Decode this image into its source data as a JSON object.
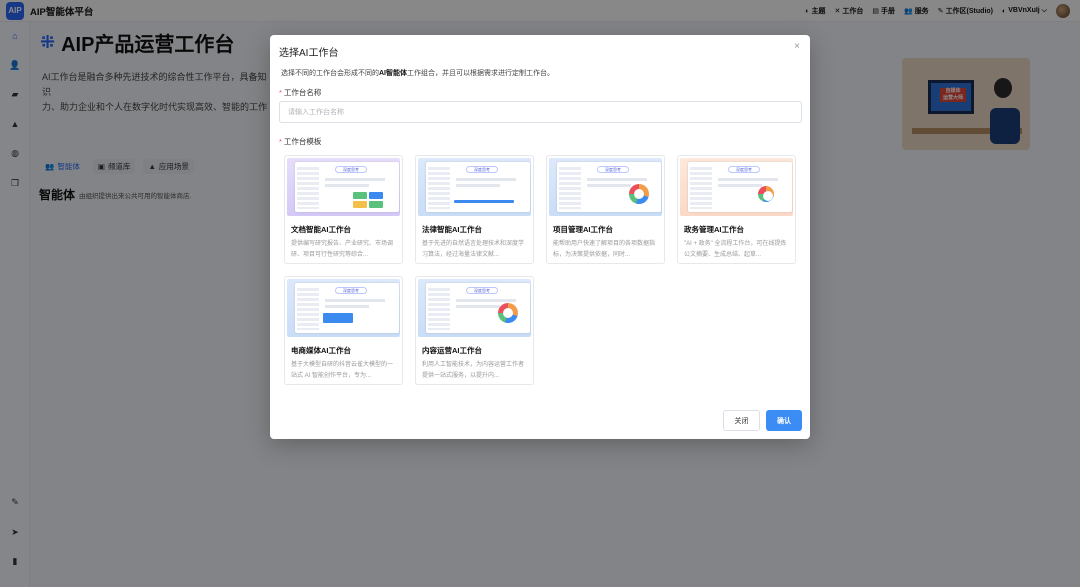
{
  "app": {
    "logo": "AIP",
    "title": "AIP智能体平台"
  },
  "topnav": [
    {
      "icon": "theme-icon",
      "glyph": "◐",
      "label": "主题"
    },
    {
      "icon": "workbench-icon",
      "glyph": "✕",
      "label": "工作台"
    },
    {
      "icon": "manual-icon",
      "glyph": "▤",
      "label": "手册"
    },
    {
      "icon": "service-icon",
      "glyph": "👥",
      "label": "服务"
    },
    {
      "icon": "workspace-icon",
      "glyph": "✎",
      "label": "工作区(Studio)"
    },
    {
      "icon": "user-icon",
      "glyph": "◐",
      "label": "VBVnXuIj ⌵"
    }
  ],
  "sidebar": [
    "home-icon",
    "user-icon",
    "box-icon",
    "layers-icon",
    "chat-icon",
    "copy-icon"
  ],
  "sidebar_bottom": [
    "pen-icon",
    "send-icon",
    "message-icon"
  ],
  "page": {
    "title": "AIP产品运营工作台",
    "intro": "AI工作台是融合多种先进技术的综合性工作平台，具备知识\n力、助力企业和个人在数字化时代实现高效、智能的工作",
    "hero_text": "自媒体\n运营大师",
    "tabs": [
      {
        "label": "智能体",
        "glyph": "👥"
      },
      {
        "label": "频道库",
        "glyph": "▣"
      },
      {
        "label": "应用场景",
        "glyph": "▲"
      }
    ],
    "section_title": "智能体",
    "section_sub": "由组织提供出来公共可用的智能体商店."
  },
  "modal": {
    "title": "选择AI工作台",
    "close_glyph": "×",
    "desc_pre": "选择不同的工作台会形成不同的",
    "desc_bold": "AI智能体",
    "desc_post": "工作组合，并且可以根据需求进行定制工作台。",
    "name_label": "工作台名称",
    "name_placeholder": "请输入工作台名称",
    "template_label": "工作台模板",
    "thumb_badge": "深度思考",
    "cards": [
      {
        "title": "文档智能AI工作台",
        "desc": "提供编写研究报告、产业研究、市场调研、项目可行性研究等综合...",
        "theme": "purple"
      },
      {
        "title": "法律智能AI工作台",
        "desc": "基于先进的自然语言处理技术和深度学习算法，经过海量法律文献...",
        "theme": "blue"
      },
      {
        "title": "项目管理AI工作台",
        "desc": "能帮助用户快速了解项目的各项数据指标，为决策提供依据，同时...",
        "theme": "blue"
      },
      {
        "title": "政务管理AI工作台",
        "desc": "\"AI + 政务\" 全流程工作台，可在线提炼公文摘要、生成总结、起草...",
        "theme": "peach"
      },
      {
        "title": "电商媒体AI工作台",
        "desc": "基于大模型自研的抖音云雀大模型的一站式 AI 智能创作平台，专为...",
        "theme": "blue"
      },
      {
        "title": "内容运营AI工作台",
        "desc": "利用人工智能技术，为内容运营工作者提供一站式服务，以提升内...",
        "theme": "blue"
      }
    ],
    "close_button": "关闭",
    "confirm_button": "确认"
  },
  "colors": {
    "accent": "#3c8cf6",
    "required": "#e34d59",
    "mask": "rgba(0,0,0,0.45)"
  }
}
